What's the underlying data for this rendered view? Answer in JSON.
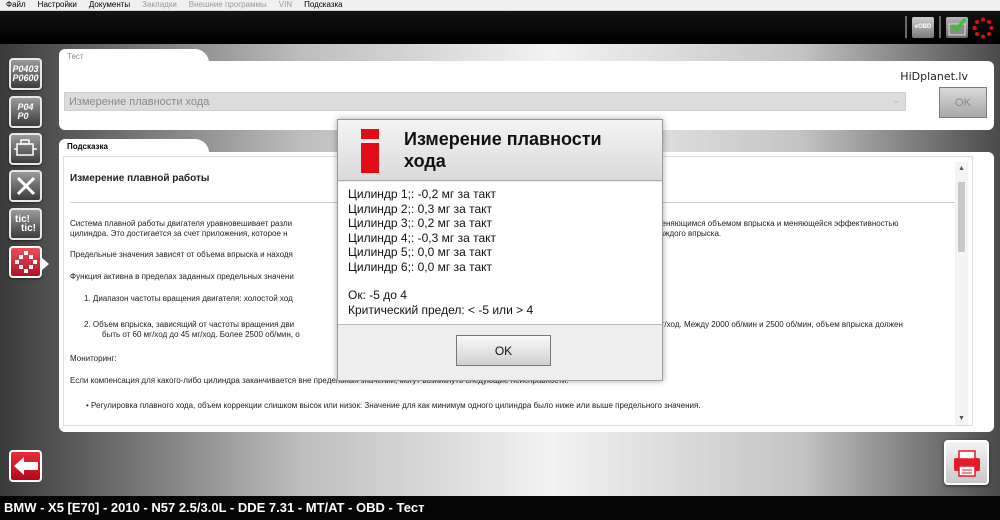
{
  "menu": {
    "items": [
      {
        "label": "Файл",
        "disabled": false
      },
      {
        "label": "Настройки",
        "disabled": false
      },
      {
        "label": "Документы",
        "disabled": false
      },
      {
        "label": "Закладки",
        "disabled": true
      },
      {
        "label": "Внешние программы",
        "disabled": true
      },
      {
        "label": "VIN",
        "disabled": true
      },
      {
        "label": "Подсказка",
        "disabled": false
      }
    ]
  },
  "toolbar": {
    "eobd_label": "eOBD",
    "icons": [
      "eobd-icon",
      "check-folder-icon",
      "gear-icon"
    ]
  },
  "sidebar": {
    "codes1": {
      "line1": "P0403",
      "line2": "P0600"
    },
    "codes2": {
      "line1": "P04",
      "line2": "P0"
    },
    "tic_label_1": "tic!",
    "tic_label_2": "tic!"
  },
  "test": {
    "tab_label": "Тест",
    "select_value": "Измерение плавности хода",
    "ok_label": "OK",
    "watermark": "HiDplanet.lv"
  },
  "help": {
    "tab_label": "Подсказка",
    "title": "Измерение плавной работы",
    "p1": "Система плавной работы двигателя уравновешивает разли",
    "p1_right": "меняющимся объемом впрыска и меняющейся эффективностью",
    "p1b": "цилиндра. Это достигается за счет приложения, которое н",
    "p1b_right": "каждого впрыска.",
    "p2": "Предельные значения зависят от объема впрыска и находя",
    "p3": "Функция активна в пределах заданных предельных значени",
    "li1": "1.   Диапазон частоты вращения двигателя: холостой ход",
    "li2a": "2.   Объем впрыска, зависящий от частоты вращения дви",
    "li2a_right": "мг/ход. Между 2000 об/мин и 2500 об/мин, объем впрыска должен",
    "li2b": "быть от 60 мг/ход до 45 мг/ход. Более 2500 об/мин, о",
    "monitoring": "Мониторинг:",
    "p4": "Если компенсация для какого-либо цилиндра заканчивается вне предельных значений, могут возникнуть следующие неисправности:",
    "bullet": "•  Регулировка плавного хода, объем коррекции слишком высок или низок: Значение для как минимум одного цилиндра было ниже или выше предельного значения."
  },
  "modal": {
    "title": "Измерение плавности хода",
    "lines": [
      "Цилиндр 1;: -0,2 мг за такт",
      "Цилиндр 2;: 0,3 мг за такт",
      "Цилиндр 3;: 0,2 мг за такт",
      "Цилиндр 4;: -0,3 мг за такт",
      "Цилиндр 5;: 0,0 мг за такт",
      "Цилиндр 6;: 0,0 мг за такт"
    ],
    "ok_range": "Ок: -5 до 4",
    "critical": "Критический предел: < -5 или > 4",
    "ok_button": "OK"
  },
  "status": {
    "text": "BMW - X5 [E70] - 2010 - N57 2.5/3.0L - DDE 7.31 - MT/AT - OBD - Тест"
  },
  "colors": {
    "accent_red": "#e10c16",
    "status_bg": "#050505"
  }
}
